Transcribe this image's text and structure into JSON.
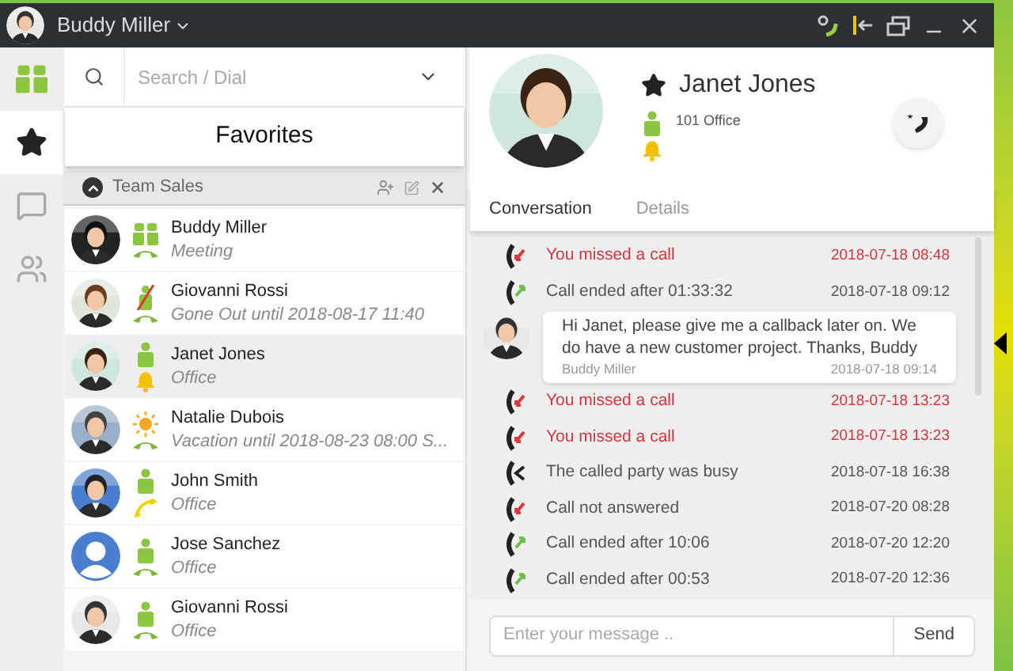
{
  "titlebar": {
    "user": "Buddy Miller"
  },
  "nav": [
    {
      "kind": "presence",
      "selected": false
    },
    {
      "kind": "favorites",
      "selected": true
    },
    {
      "kind": "chat",
      "selected": false
    },
    {
      "kind": "groups",
      "selected": false
    }
  ],
  "search": {
    "placeholder": "Search / Dial"
  },
  "list_title": "Favorites",
  "group": {
    "name": "Team Sales",
    "expanded": true
  },
  "contacts": [
    {
      "name": "Buddy Miller",
      "status": "Meeting",
      "presence": {
        "kind": "team"
      },
      "phone": {
        "kind": "idle"
      },
      "selected": false
    },
    {
      "name": "Giovanni Rossi",
      "status": "Gone Out until 2018-08-17 11:40",
      "presence": {
        "kind": "away"
      },
      "phone": {
        "kind": "idle"
      },
      "selected": false
    },
    {
      "name": "Janet Jones",
      "status": "Office",
      "presence": {
        "kind": "available"
      },
      "phone": {
        "kind": "ringing"
      },
      "selected": true
    },
    {
      "name": "Natalie Dubois",
      "status": "Vacation until 2018-08-23 08:00 S...",
      "presence": {
        "kind": "vacation"
      },
      "phone": {
        "kind": "idle"
      },
      "selected": false
    },
    {
      "name": "John Smith",
      "status": "Office",
      "presence": {
        "kind": "available"
      },
      "phone": {
        "kind": "busy"
      },
      "selected": false
    },
    {
      "name": "Jose Sanchez",
      "status": "Office",
      "avatar": {
        "kind": "silhouette"
      },
      "presence": {
        "kind": "available"
      },
      "phone": {
        "kind": "idle"
      },
      "selected": false
    },
    {
      "name": "Giovanni Rossi",
      "status": "Office",
      "presence": {
        "kind": "available"
      },
      "phone": {
        "kind": "idle"
      },
      "selected": false
    }
  ],
  "detail": {
    "name": "Janet Jones",
    "favorite": true,
    "line": "101 Office",
    "presence": {
      "kind": "available"
    },
    "phone": {
      "kind": "ringing"
    }
  },
  "tabs": [
    {
      "label": "Conversation",
      "selected": true
    },
    {
      "label": "Details",
      "selected": false
    }
  ],
  "log": [
    {
      "kind": "missed",
      "text": "You missed a call",
      "time": "2018-07-18 08:48"
    },
    {
      "kind": "ended",
      "text": "Call ended after 01:33:32",
      "time": "2018-07-18 09:12"
    },
    {
      "kind": "message",
      "text": "Hi Janet, please give me a callback later on. We do have a new customer project. Thanks, Buddy",
      "author": "Buddy Miller",
      "time": "2018-07-18 09:14"
    },
    {
      "kind": "missed",
      "text": "You missed a call",
      "time": "2018-07-18 13:23"
    },
    {
      "kind": "missed",
      "text": "You missed a call",
      "time": "2018-07-18 13:23"
    },
    {
      "kind": "busy",
      "text": "The called party was busy",
      "time": "2018-07-18 16:38"
    },
    {
      "kind": "not_answered",
      "text": "Call not answered",
      "time": "2018-07-20 08:28"
    },
    {
      "kind": "ended",
      "text": "Call ended after 10:06",
      "time": "2018-07-20 12:20"
    },
    {
      "kind": "ended",
      "text": "Call ended after 00:53",
      "time": "2018-07-20 12:36"
    }
  ],
  "composer": {
    "placeholder": "Enter your message ..",
    "send": "Send"
  }
}
